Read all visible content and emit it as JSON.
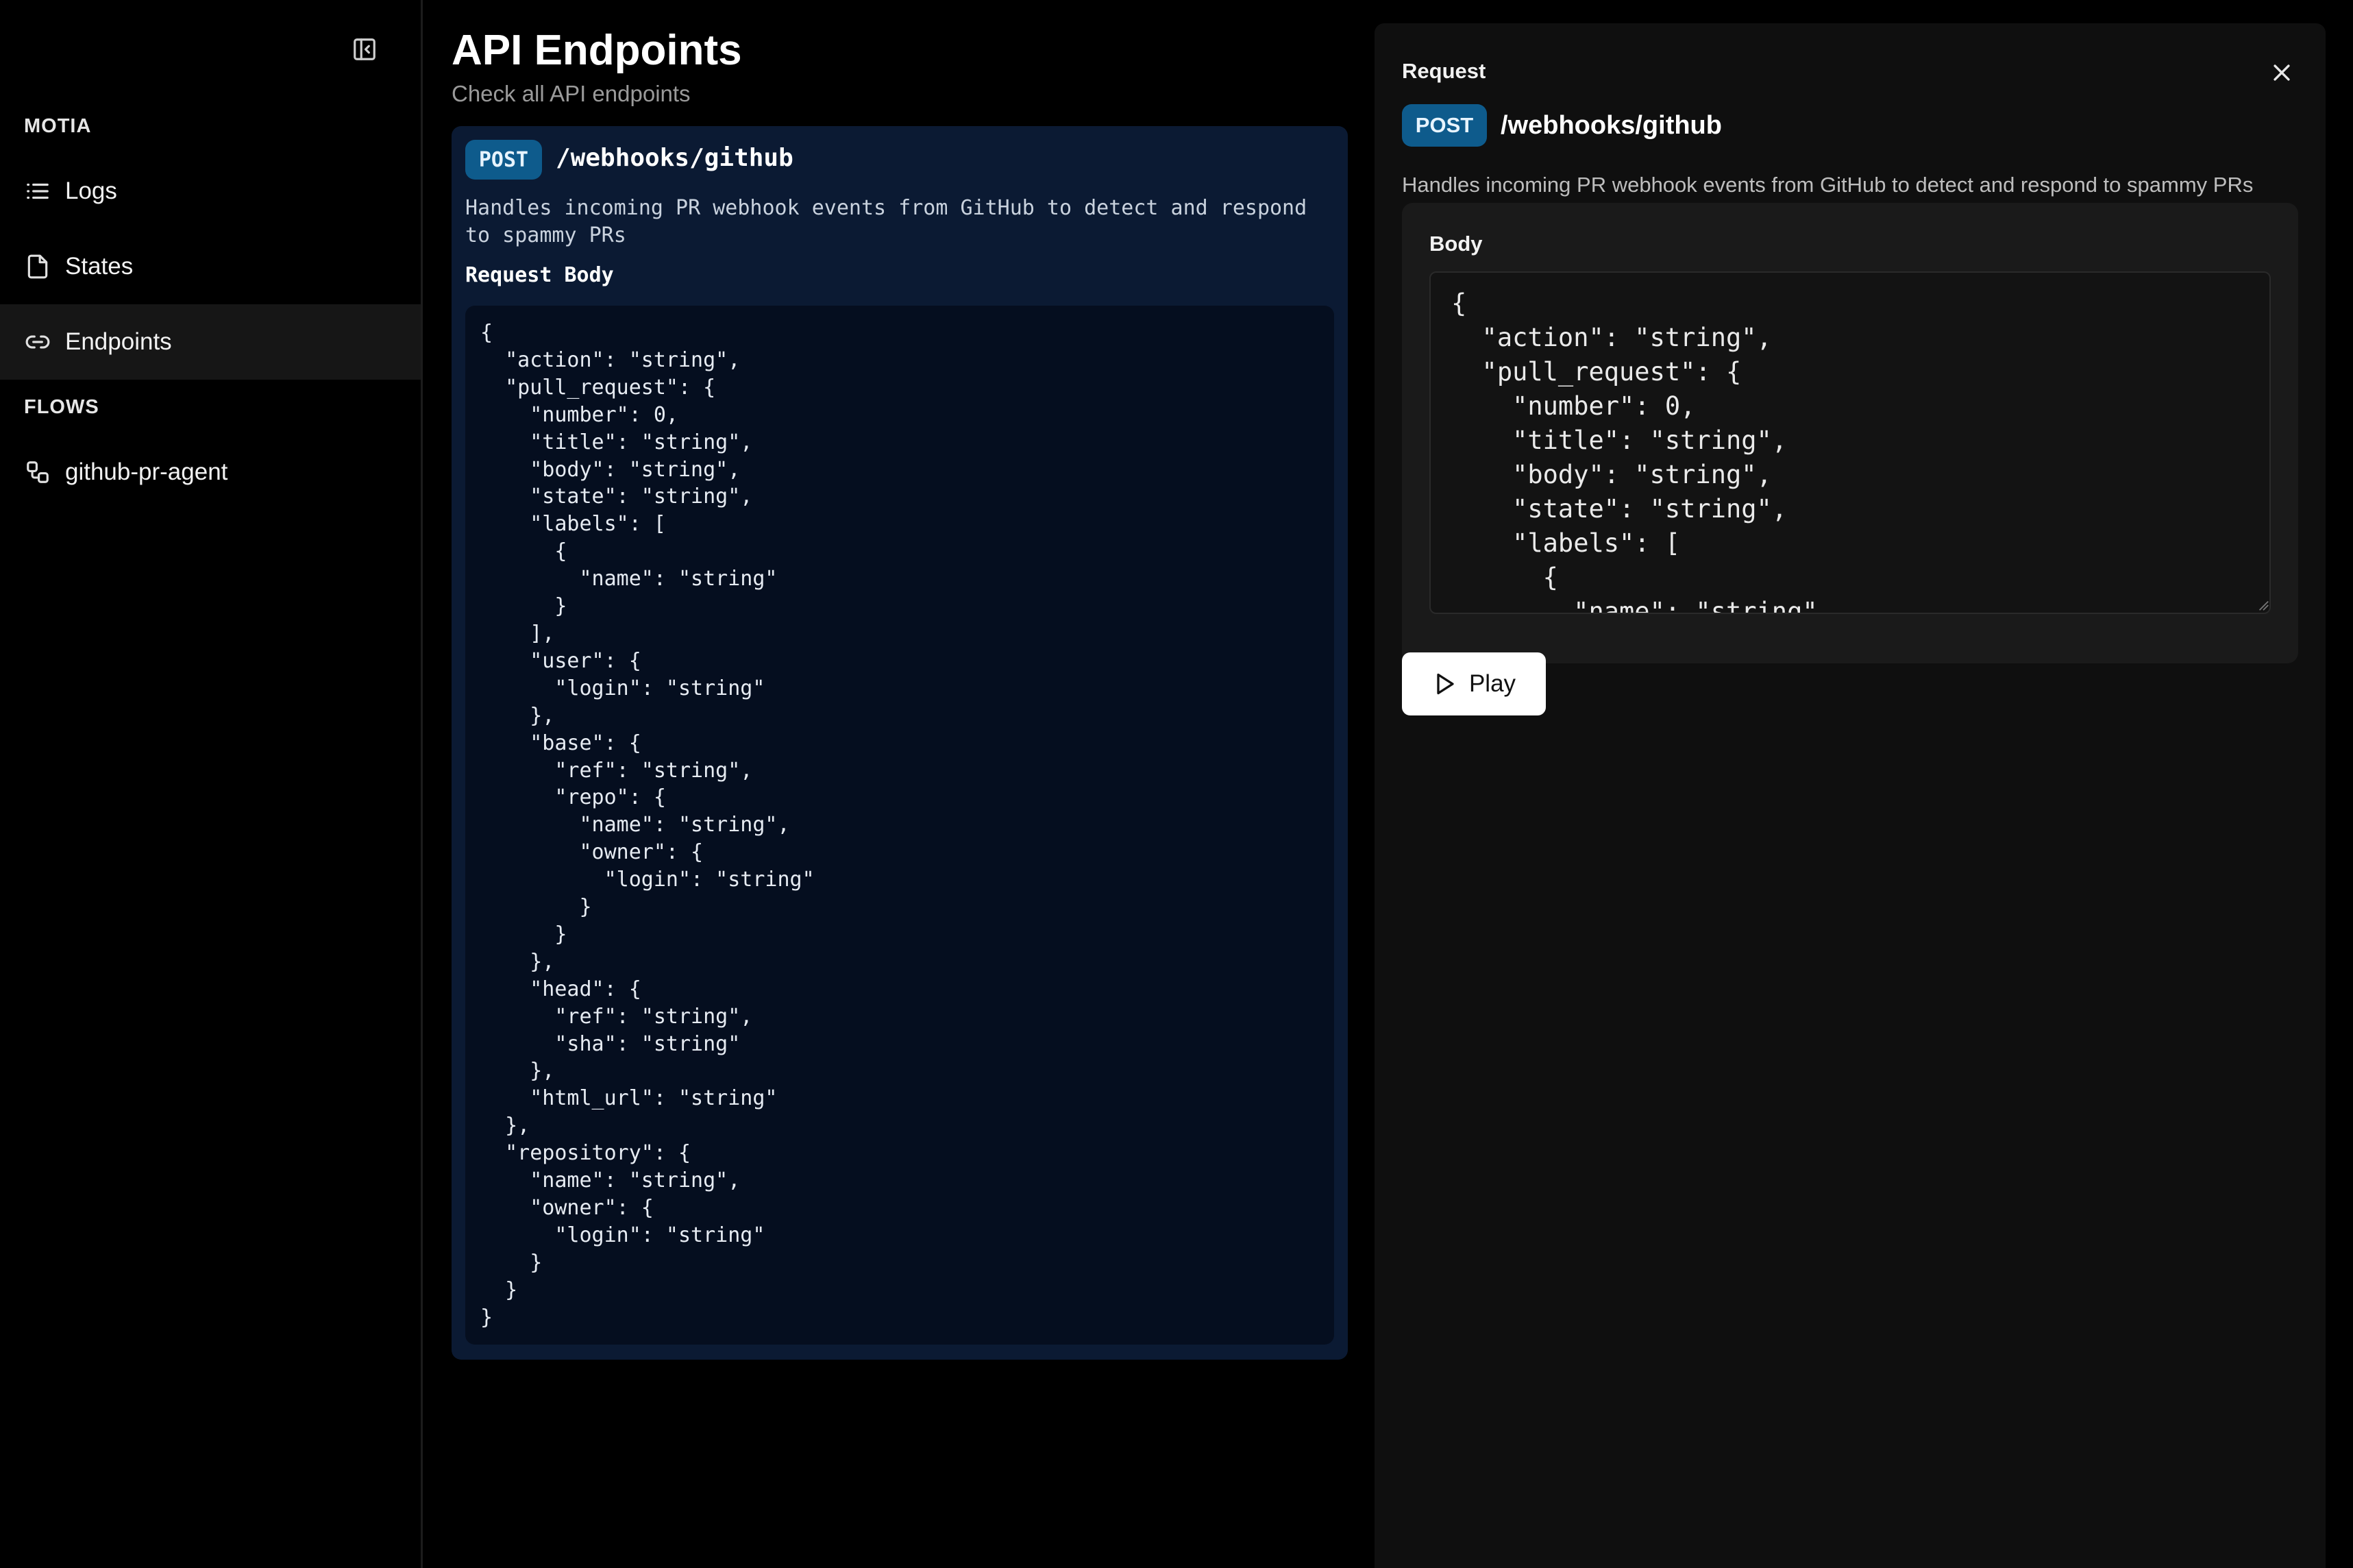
{
  "sidebar": {
    "section_main": "MOTIA",
    "items": [
      {
        "label": "Logs",
        "icon": "list-icon"
      },
      {
        "label": "States",
        "icon": "file-icon"
      },
      {
        "label": "Endpoints",
        "icon": "link-icon",
        "active": true
      }
    ],
    "section_flows": "FLOWS",
    "flows": [
      {
        "label": "github-pr-agent",
        "icon": "workflow-icon"
      }
    ]
  },
  "main": {
    "title": "API Endpoints",
    "subtitle": "Check all API endpoints",
    "endpoint": {
      "method": "POST",
      "path": "/webhooks/github",
      "description": "Handles incoming PR webhook events from GitHub to detect and respond to spammy PRs",
      "body_label": "Request Body",
      "body_code": "{\n  \"action\": \"string\",\n  \"pull_request\": {\n    \"number\": 0,\n    \"title\": \"string\",\n    \"body\": \"string\",\n    \"state\": \"string\",\n    \"labels\": [\n      {\n        \"name\": \"string\"\n      }\n    ],\n    \"user\": {\n      \"login\": \"string\"\n    },\n    \"base\": {\n      \"ref\": \"string\",\n      \"repo\": {\n        \"name\": \"string\",\n        \"owner\": {\n          \"login\": \"string\"\n        }\n      }\n    },\n    \"head\": {\n      \"ref\": \"string\",\n      \"sha\": \"string\"\n    },\n    \"html_url\": \"string\"\n  },\n  \"repository\": {\n    \"name\": \"string\",\n    \"owner\": {\n      \"login\": \"string\"\n    }\n  }\n}"
    }
  },
  "panel": {
    "title": "Request",
    "method": "POST",
    "path": "/webhooks/github",
    "description": "Handles incoming PR webhook events from GitHub to detect and respond to spammy PRs",
    "body_label": "Body",
    "body_value": "{\n  \"action\": \"string\",\n  \"pull_request\": {\n    \"number\": 0,\n    \"title\": \"string\",\n    \"body\": \"string\",\n    \"state\": \"string\",\n    \"labels\": [\n      {\n        \"name\": \"string\"\n      }\n    ]\n  }\n}",
    "play_label": "Play"
  },
  "colors": {
    "badge_bg": "#0e5b8c",
    "card_bg": "#0b1a33",
    "panel_bg": "#0f0f0f"
  }
}
